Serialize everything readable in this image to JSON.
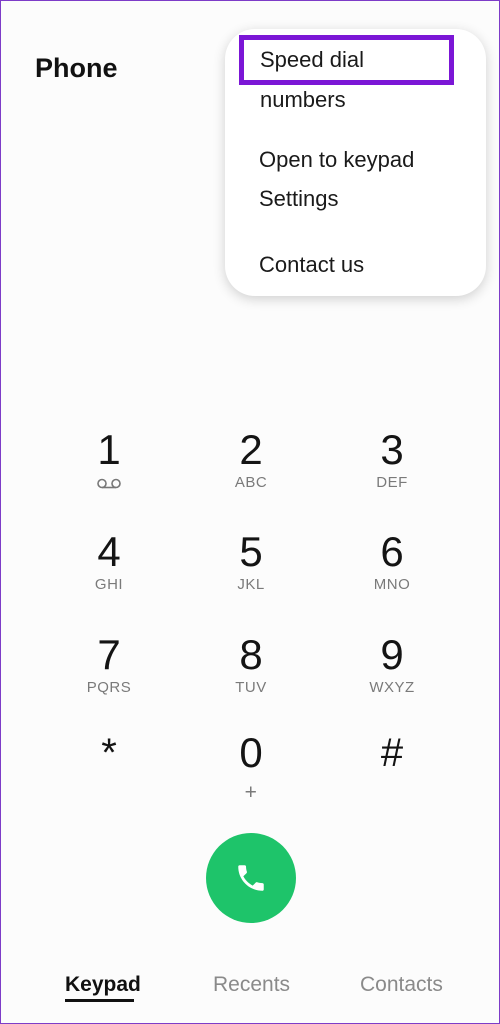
{
  "header": {
    "title": "Phone"
  },
  "menu": {
    "items": [
      {
        "label": "Speed dial numbers",
        "highlighted": true
      },
      {
        "label": "Open to keypad"
      },
      {
        "label": "Settings"
      },
      {
        "label": "Contact us"
      }
    ]
  },
  "keypad": {
    "keys": [
      {
        "digit": "1",
        "letters": "",
        "icon": "voicemail-icon"
      },
      {
        "digit": "2",
        "letters": "ABC"
      },
      {
        "digit": "3",
        "letters": "DEF"
      },
      {
        "digit": "4",
        "letters": "GHI"
      },
      {
        "digit": "5",
        "letters": "JKL"
      },
      {
        "digit": "6",
        "letters": "MNO"
      },
      {
        "digit": "7",
        "letters": "PQRS"
      },
      {
        "digit": "8",
        "letters": "TUV"
      },
      {
        "digit": "9",
        "letters": "WXYZ"
      },
      {
        "digit": "*",
        "letters": ""
      },
      {
        "digit": "0",
        "letters": "+"
      },
      {
        "digit": "#",
        "letters": ""
      }
    ]
  },
  "call_button": {
    "icon": "phone-icon",
    "color": "#1ec46a"
  },
  "tabs": [
    {
      "label": "Keypad",
      "active": true
    },
    {
      "label": "Recents"
    },
    {
      "label": "Contacts"
    }
  ],
  "colors": {
    "highlight": "#7b16d6",
    "border": "#7d3cc8"
  }
}
